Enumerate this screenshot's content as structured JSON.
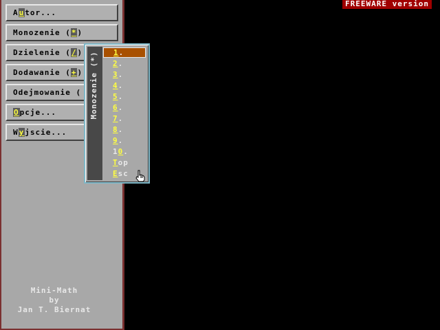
{
  "badge": "FREEWARE version",
  "menu": [
    {
      "pre": "A",
      "key": "u",
      "post": "tor..."
    },
    {
      "pre": "Monozenie (",
      "key": "*",
      "post": ")"
    },
    {
      "pre": "Dzielenie (",
      "key": "/",
      "post": ")"
    },
    {
      "pre": "Dodawanie (",
      "key": "+",
      "post": ")"
    },
    {
      "pre": "Odejmowanie (",
      "key": "",
      "post": ""
    },
    {
      "pre": "",
      "key": "O",
      "post": "pcje..."
    },
    {
      "pre": "W",
      "key": "y",
      "post": "jscie..."
    }
  ],
  "credits": {
    "line1": "Mini-Math",
    "line2": "by",
    "line3": "Jan T. Biernat"
  },
  "popup": {
    "title": "Monozenie (*)",
    "items": [
      {
        "pre": "",
        "key": "1",
        "post": "."
      },
      {
        "pre": "",
        "key": "2",
        "post": "."
      },
      {
        "pre": "",
        "key": "3",
        "post": "."
      },
      {
        "pre": "",
        "key": "4",
        "post": "."
      },
      {
        "pre": "",
        "key": "5",
        "post": "."
      },
      {
        "pre": "",
        "key": "6",
        "post": "."
      },
      {
        "pre": "",
        "key": "7",
        "post": "."
      },
      {
        "pre": "",
        "key": "8",
        "post": "."
      },
      {
        "pre": "",
        "key": "9",
        "post": "."
      },
      {
        "pre": "1",
        "key": "0",
        "post": "."
      },
      {
        "pre": "",
        "key": "T",
        "post": "op"
      },
      {
        "pre": "",
        "key": "E",
        "post": "sc"
      }
    ],
    "selected_index": 0
  },
  "cursor_icon": "hand-pointer-icon"
}
